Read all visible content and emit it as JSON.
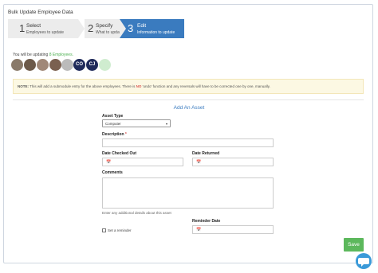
{
  "page": {
    "title": "Bulk Update Employee Data"
  },
  "wizard": {
    "steps": [
      {
        "num": "1",
        "title": "Select",
        "subtitle": "Employees to update"
      },
      {
        "num": "2",
        "title": "Specify",
        "subtitle": "What to update"
      },
      {
        "num": "3",
        "title": "Edit",
        "subtitle": "Information to update"
      }
    ],
    "active_step": 3,
    "active_color": "#3a7bbf"
  },
  "updating": {
    "prefix": "You will be updating",
    "count": "8 Employees."
  },
  "avatars": [
    {
      "type": "photo",
      "color": "#8a7a6a"
    },
    {
      "type": "photo",
      "color": "#6d5a4a"
    },
    {
      "type": "photo",
      "color": "#a08878"
    },
    {
      "type": "photo",
      "color": "#7a6050"
    },
    {
      "type": "photo",
      "color": "#bbbbbb"
    },
    {
      "type": "initials",
      "initials": "CO",
      "color": "#1f2a5a"
    },
    {
      "type": "initials",
      "initials": "CJ",
      "color": "#1f2a5a"
    },
    {
      "type": "placeholder",
      "color": "#cfeccf"
    }
  ],
  "note": {
    "label": "NOTE:",
    "text_before": " This will add a submodule entry for the above employees. There is ",
    "emphasis": "NO",
    "text_after": " 'undo' function and any reversals will have to be corrected one by one, manually."
  },
  "form": {
    "section_title": "Add An Asset",
    "asset_type": {
      "label": "Asset Type",
      "value": "Computer"
    },
    "description": {
      "label": "Description",
      "required_mark": "*",
      "value": ""
    },
    "date_checked_out": {
      "label": "Date Checked Out",
      "value": ""
    },
    "date_returned": {
      "label": "Date Returned",
      "value": ""
    },
    "comments": {
      "label": "Comments",
      "value": "",
      "hint": "Enter any additional details about this asset"
    },
    "set_reminder": {
      "label": "Set a reminder",
      "checked": false
    },
    "reminder_date": {
      "label": "Reminder Date",
      "value": ""
    }
  },
  "actions": {
    "save_label": "Save",
    "save_color": "#5cb85c"
  },
  "icons": {
    "date": "calendar-icon",
    "chat": "chat-bubble-icon",
    "select": "chevron-down-icon"
  }
}
